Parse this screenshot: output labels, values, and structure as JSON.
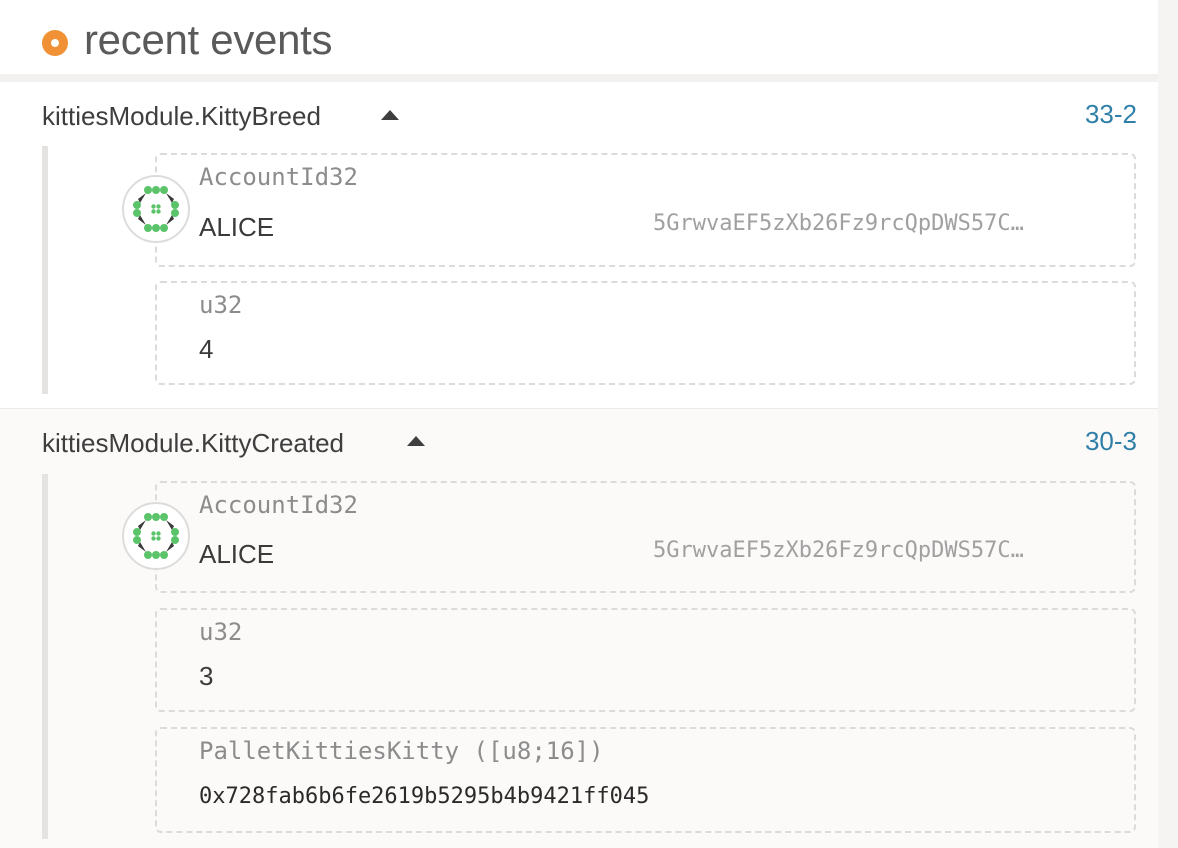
{
  "header": {
    "title": "recent events"
  },
  "events": [
    {
      "name": "kittiesModule.KittyBreed",
      "id": "33-2",
      "params": [
        {
          "type": "AccountId32",
          "value": "ALICE",
          "address": "5GrwvaEF5zXb26Fz9rcQpDWS57C…"
        },
        {
          "type": "u32",
          "value": "4"
        }
      ]
    },
    {
      "name": "kittiesModule.KittyCreated",
      "id": "30-3",
      "params": [
        {
          "type": "AccountId32",
          "value": "ALICE",
          "address": "5GrwvaEF5zXb26Fz9rcQpDWS57C…"
        },
        {
          "type": "u32",
          "value": "3"
        },
        {
          "type": "PalletKittiesKitty ([u8;16])",
          "value": "0x728fab6b6fe2619b5295b4b9421ff045"
        }
      ]
    }
  ],
  "colors": {
    "accent_orange": "#f19135",
    "link_blue": "#2f7fa8",
    "identicon_green": "#5bc46a",
    "identicon_dark": "#3a3a3a"
  },
  "icons": {
    "header_marker": "orange-dot-icon",
    "toggle": "caret-up-icon",
    "account": "identicon-icon"
  }
}
